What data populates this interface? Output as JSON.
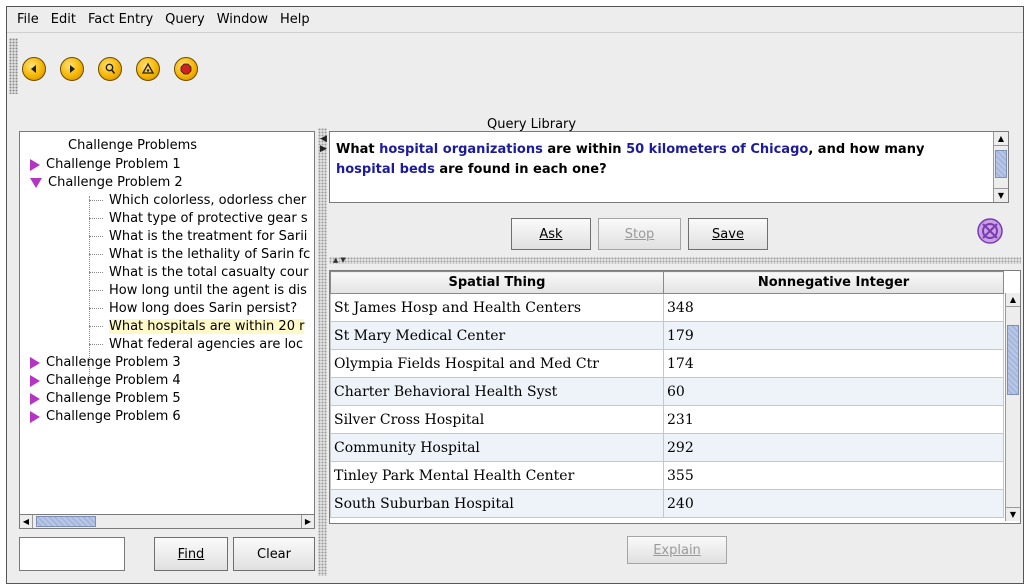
{
  "menu": [
    "File",
    "Edit",
    "Fact Entry",
    "Query",
    "Window",
    "Help"
  ],
  "toolbar": {
    "buttons": [
      {
        "name": "back-icon"
      },
      {
        "name": "forward-icon"
      },
      {
        "name": "search-person-icon"
      },
      {
        "name": "hazard-icon"
      },
      {
        "name": "stop-sign-icon"
      }
    ],
    "accent": "#f5b500"
  },
  "library_title": "Query Library",
  "tree": {
    "root": "Challenge Problems",
    "problems": [
      {
        "label": "Challenge Problem 1",
        "expanded": false
      },
      {
        "label": "Challenge Problem 2",
        "expanded": true
      },
      {
        "label": "Challenge Problem 3",
        "expanded": false
      },
      {
        "label": "Challenge Problem 4",
        "expanded": false
      },
      {
        "label": "Challenge Problem 5",
        "expanded": false
      },
      {
        "label": "Challenge Problem 6",
        "expanded": false
      }
    ],
    "leaves": [
      "Which colorless, odorless cher",
      "What type of protective gear s",
      "What is the treatment for Sarii",
      "What is the lethality of Sarin fc",
      "What is the total casualty cour",
      "How long until the agent is dis",
      "How long does Sarin persist?",
      "What hospitals are within 20 r",
      "What federal agencies are loc"
    ],
    "selected_leaf_index": 7
  },
  "search": {
    "value": "",
    "find_label": "Find",
    "clear_label": "Clear"
  },
  "question": {
    "parts": [
      {
        "text": "What ",
        "link": false
      },
      {
        "text": "hospital organizations",
        "link": true
      },
      {
        "text": " are within ",
        "link": false
      },
      {
        "text": "50 kilometers of Chicago",
        "link": true
      },
      {
        "text": ", and how many ",
        "link": false
      },
      {
        "text": "hospital beds",
        "link": true
      },
      {
        "text": " are found in each one?",
        "link": false
      }
    ]
  },
  "actions": {
    "ask": "Ask",
    "stop": "Stop",
    "save": "Save",
    "explain": "Explain"
  },
  "results": {
    "columns": [
      "Spatial Thing",
      "Nonnegative Integer"
    ],
    "rows": [
      [
        "St James Hosp and Health Centers",
        "348"
      ],
      [
        "St Mary Medical Center",
        "179"
      ],
      [
        "Olympia Fields Hospital and Med Ctr",
        "174"
      ],
      [
        "Charter Behavioral Health Syst",
        "60"
      ],
      [
        "Silver Cross Hospital",
        "231"
      ],
      [
        "Community Hospital",
        "292"
      ],
      [
        "Tinley Park Mental Health Center",
        "355"
      ],
      [
        "South Suburban Hospital",
        "240"
      ]
    ]
  }
}
